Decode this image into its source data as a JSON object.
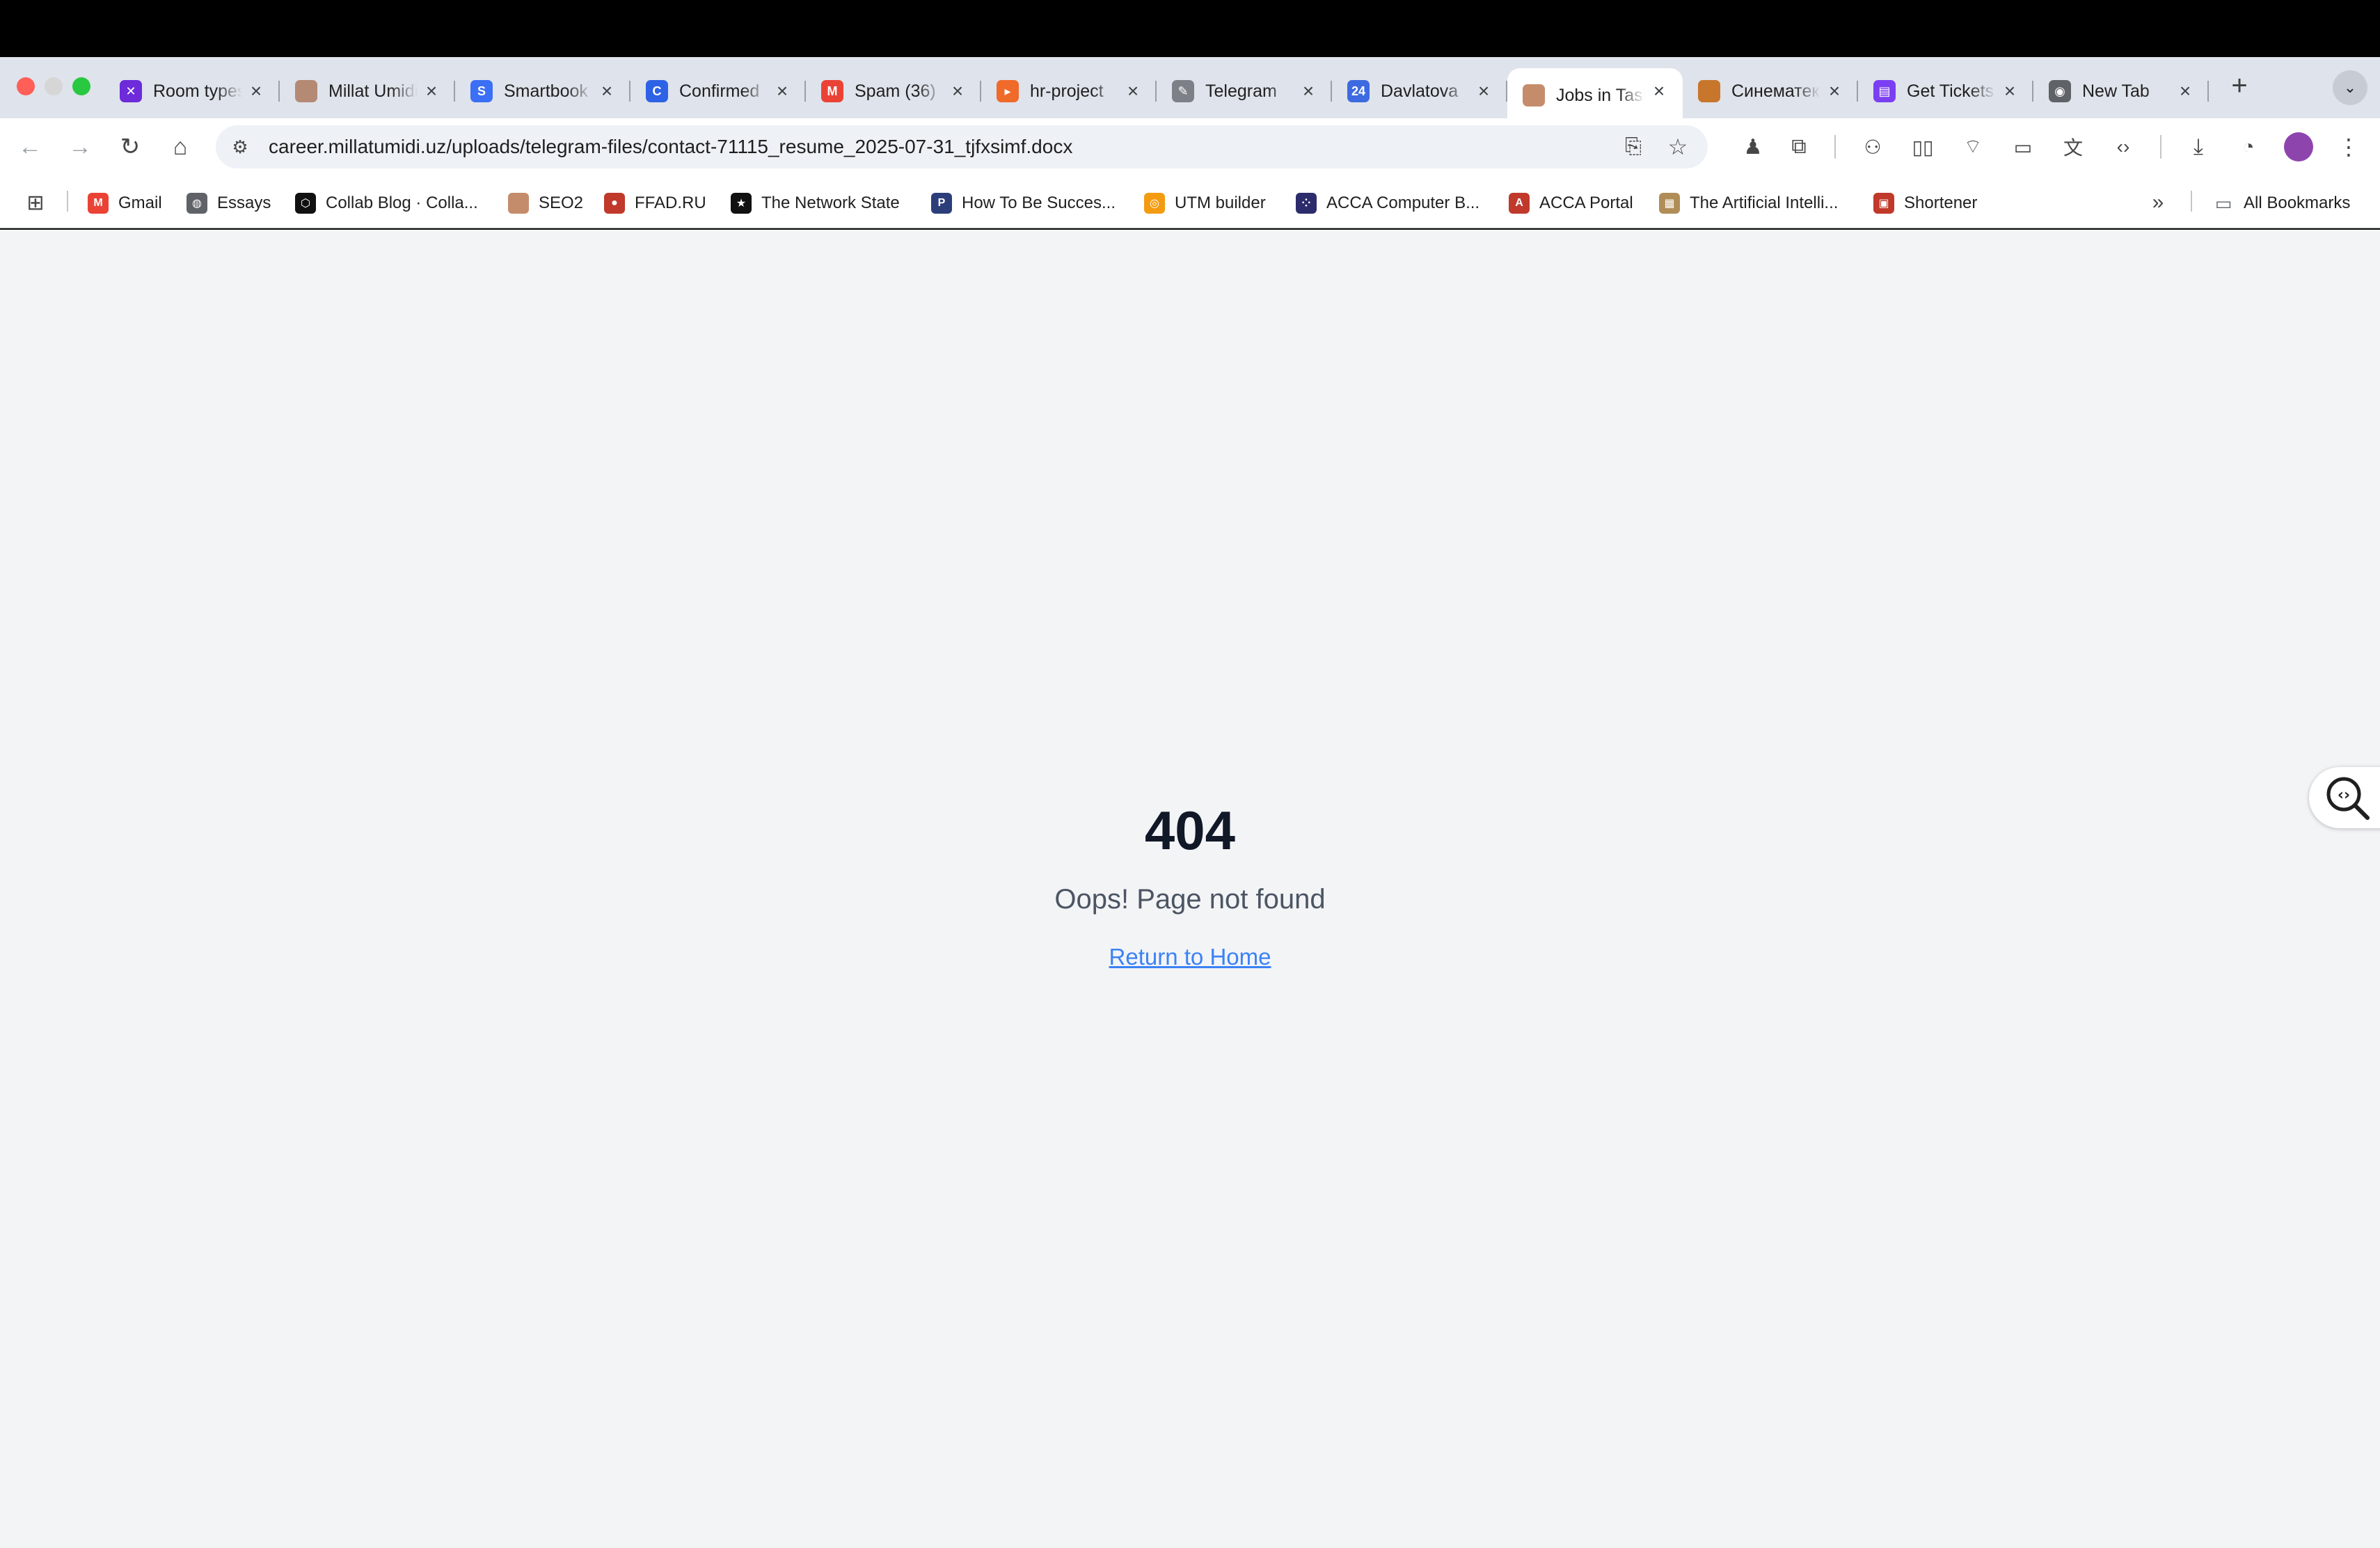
{
  "window": {
    "traffic_lights": [
      "#ff5f57",
      "#d6d6d6",
      "#28c840"
    ]
  },
  "tabs": [
    {
      "title": "Room types",
      "icon": "x-purple-icon",
      "color": "#6d2bd9",
      "glyph": "✕"
    },
    {
      "title": "Millat Umidi",
      "icon": "millat-umidi-icon",
      "color": "#b48a74",
      "glyph": ""
    },
    {
      "title": "Smartbook",
      "icon": "smartbook-icon",
      "color": "#3b6ff5",
      "glyph": "S"
    },
    {
      "title": "Confirmed",
      "icon": "confirmed-icon",
      "color": "#2d62e6",
      "glyph": "C"
    },
    {
      "title": "Spam (36)",
      "icon": "gmail-icon",
      "color": "#ea4335",
      "glyph": "M"
    },
    {
      "title": "hr-project",
      "icon": "hr-project-icon",
      "color": "#f06a2a",
      "glyph": "▸"
    },
    {
      "title": "Telegram",
      "icon": "telegram-icon",
      "color": "#7d8187",
      "glyph": "✎"
    },
    {
      "title": "Davlatova",
      "icon": "davlatova-icon",
      "color": "#3d6ae0",
      "glyph": "24"
    },
    {
      "title": "Jobs in Tashkent",
      "icon": "jobs-icon",
      "color": "#c58c6c",
      "glyph": "",
      "active": true
    },
    {
      "title": "Синематека",
      "icon": "cinematheque-icon",
      "color": "#c7762c",
      "glyph": ""
    },
    {
      "title": "Get Tickets",
      "icon": "get-tickets-icon",
      "color": "#7b3ff2",
      "glyph": "▤"
    },
    {
      "title": "New Tab",
      "icon": "chrome-icon",
      "color": "#5f6368",
      "glyph": "◉"
    }
  ],
  "tab_new_label": "+",
  "tab_search_label": "⌄",
  "omnibox": {
    "url": "career.millatumidi.uz/uploads/telegram-files/contact-71115_resume_2025-07-31_tjfxsimf.docx"
  },
  "bookmarks": [
    {
      "label": "Gmail",
      "icon": "gmail-icon",
      "color": "#ea4335",
      "glyph": "M"
    },
    {
      "label": "Essays",
      "icon": "globe-icon",
      "color": "#5f6368",
      "glyph": "◍"
    },
    {
      "label": "Collab Blog · Colla...",
      "icon": "collab-icon",
      "color": "#111111",
      "glyph": "⬡"
    },
    {
      "label": "SEO2",
      "icon": "seo-icon",
      "color": "#c58c6c",
      "glyph": ""
    },
    {
      "label": "FFAD.RU",
      "icon": "ffad-icon",
      "color": "#c0392b",
      "glyph": "●"
    },
    {
      "label": "The Network State",
      "icon": "network-state-icon",
      "color": "#111111",
      "glyph": "★"
    },
    {
      "label": "How To Be Succes...",
      "icon": "succes-icon",
      "color": "#2c3e7a",
      "glyph": "P"
    },
    {
      "label": "UTM builder",
      "icon": "utm-icon",
      "color": "#f39c12",
      "glyph": "◎"
    },
    {
      "label": "ACCA Computer B...",
      "icon": "acca-dots-icon",
      "color": "#2c2c6c",
      "glyph": "⁘"
    },
    {
      "label": "ACCA Portal",
      "icon": "acca-icon",
      "color": "#c0392b",
      "glyph": "A"
    },
    {
      "label": "The Artificial Intelli...",
      "icon": "ai-book-icon",
      "color": "#b08d57",
      "glyph": "▦"
    },
    {
      "label": "Shortener",
      "icon": "shortener-icon",
      "color": "#c0392b",
      "glyph": "▣"
    }
  ],
  "bookmarks_more": "»",
  "all_bookmarks": "All Bookmarks",
  "page": {
    "code": "404",
    "message": "Oops! Page not found",
    "link": "Return to Home"
  }
}
